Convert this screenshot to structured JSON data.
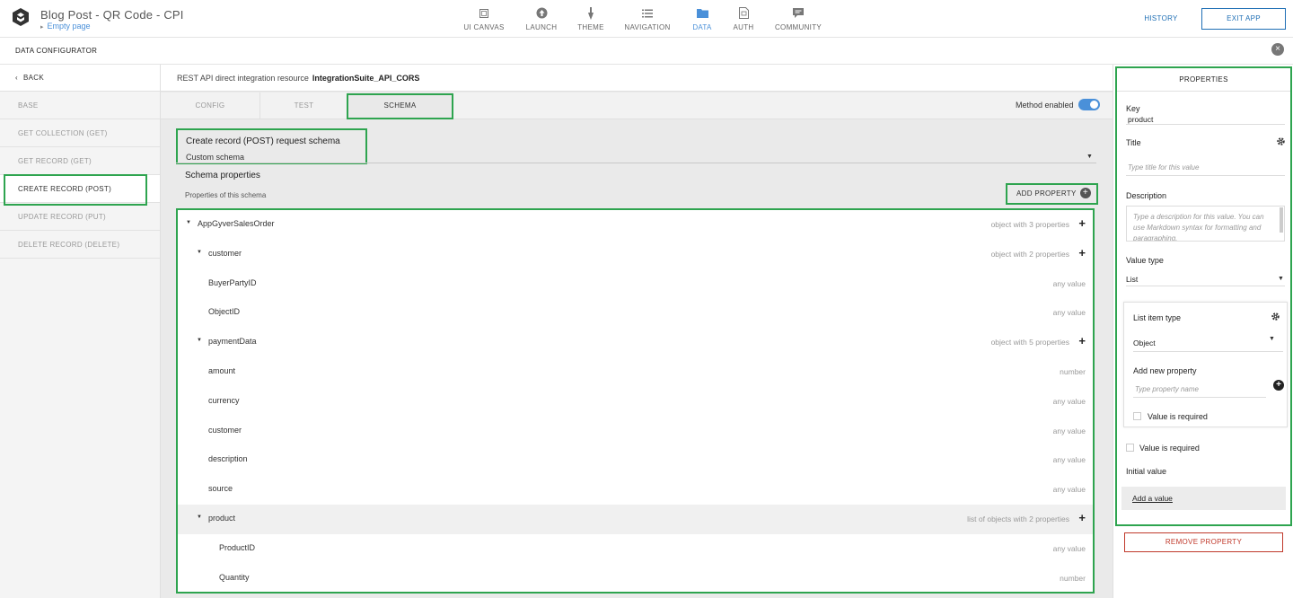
{
  "app": {
    "title": "Blog Post - QR Code - CPI",
    "page": "Empty page",
    "history": "HISTORY",
    "exit": "EXIT APP"
  },
  "nav": [
    {
      "label": "UI CANVAS",
      "icon": "canvas-icon"
    },
    {
      "label": "LAUNCH",
      "icon": "upload-icon"
    },
    {
      "label": "THEME",
      "icon": "brush-icon"
    },
    {
      "label": "NAVIGATION",
      "icon": "list-icon"
    },
    {
      "label": "DATA",
      "icon": "folder-icon",
      "active": true
    },
    {
      "label": "AUTH",
      "icon": "auth-icon"
    },
    {
      "label": "COMMUNITY",
      "icon": "chat-icon"
    }
  ],
  "configurator": {
    "title": "DATA CONFIGURATOR"
  },
  "sidebar": {
    "back": "BACK",
    "items": [
      {
        "label": "BASE"
      },
      {
        "label": "GET COLLECTION (GET)"
      },
      {
        "label": "GET RECORD (GET)"
      },
      {
        "label": "CREATE RECORD (POST)",
        "active": true
      },
      {
        "label": "UPDATE RECORD (PUT)"
      },
      {
        "label": "DELETE RECORD (DELETE)"
      }
    ]
  },
  "resource": {
    "label": "REST API direct integration resource",
    "name": "IntegrationSuite_API_CORS"
  },
  "tabs": [
    {
      "label": "CONFIG"
    },
    {
      "label": "TEST"
    },
    {
      "label": "SCHEMA",
      "active": true
    }
  ],
  "method_enabled": "Method enabled",
  "schema": {
    "title": "Create record (POST) request schema",
    "type": "Custom schema",
    "props_title": "Schema properties",
    "props_sub": "Properties of this schema",
    "add_property": "ADD PROPERTY"
  },
  "tree": [
    {
      "name": "AppGyverSalesOrder",
      "type": "object with 3 properties",
      "level": 0,
      "expandable": true,
      "addable": true
    },
    {
      "name": "customer",
      "type": "object with 2 properties",
      "level": 1,
      "expandable": true,
      "addable": true
    },
    {
      "name": "BuyerPartyID",
      "type": "any value",
      "level": 2
    },
    {
      "name": "ObjectID",
      "type": "any value",
      "level": 2
    },
    {
      "name": "paymentData",
      "type": "object with 5 properties",
      "level": 1,
      "expandable": true,
      "addable": true
    },
    {
      "name": "amount",
      "type": "number",
      "level": 2
    },
    {
      "name": "currency",
      "type": "any value",
      "level": 2
    },
    {
      "name": "customer",
      "type": "any value",
      "level": 2
    },
    {
      "name": "description",
      "type": "any value",
      "level": 2
    },
    {
      "name": "source",
      "type": "any value",
      "level": 2
    },
    {
      "name": "product",
      "type": "list of objects with 2 properties",
      "level": 1,
      "expandable": true,
      "addable": true,
      "highlight": true
    },
    {
      "name": "ProductID",
      "type": "any value",
      "level": 3
    },
    {
      "name": "Quantity",
      "type": "number",
      "level": 3
    }
  ],
  "properties": {
    "title": "PROPERTIES",
    "key_label": "Key",
    "key_value": "product",
    "title_label": "Title",
    "title_placeholder": "Type title for this value",
    "description_label": "Description",
    "description_placeholder": "Type a description for this value. You can use Markdown syntax for formatting and paragraphing.",
    "value_type_label": "Value type",
    "value_type": "List",
    "list_item_type_label": "List item type",
    "list_item_type": "Object",
    "add_new_property_label": "Add new property",
    "property_name_placeholder": "Type property name",
    "inner_required": "Value is required",
    "outer_required": "Value is required",
    "initial_value_label": "Initial value",
    "add_value": "Add a value",
    "remove_property": "REMOVE PROPERTY"
  }
}
